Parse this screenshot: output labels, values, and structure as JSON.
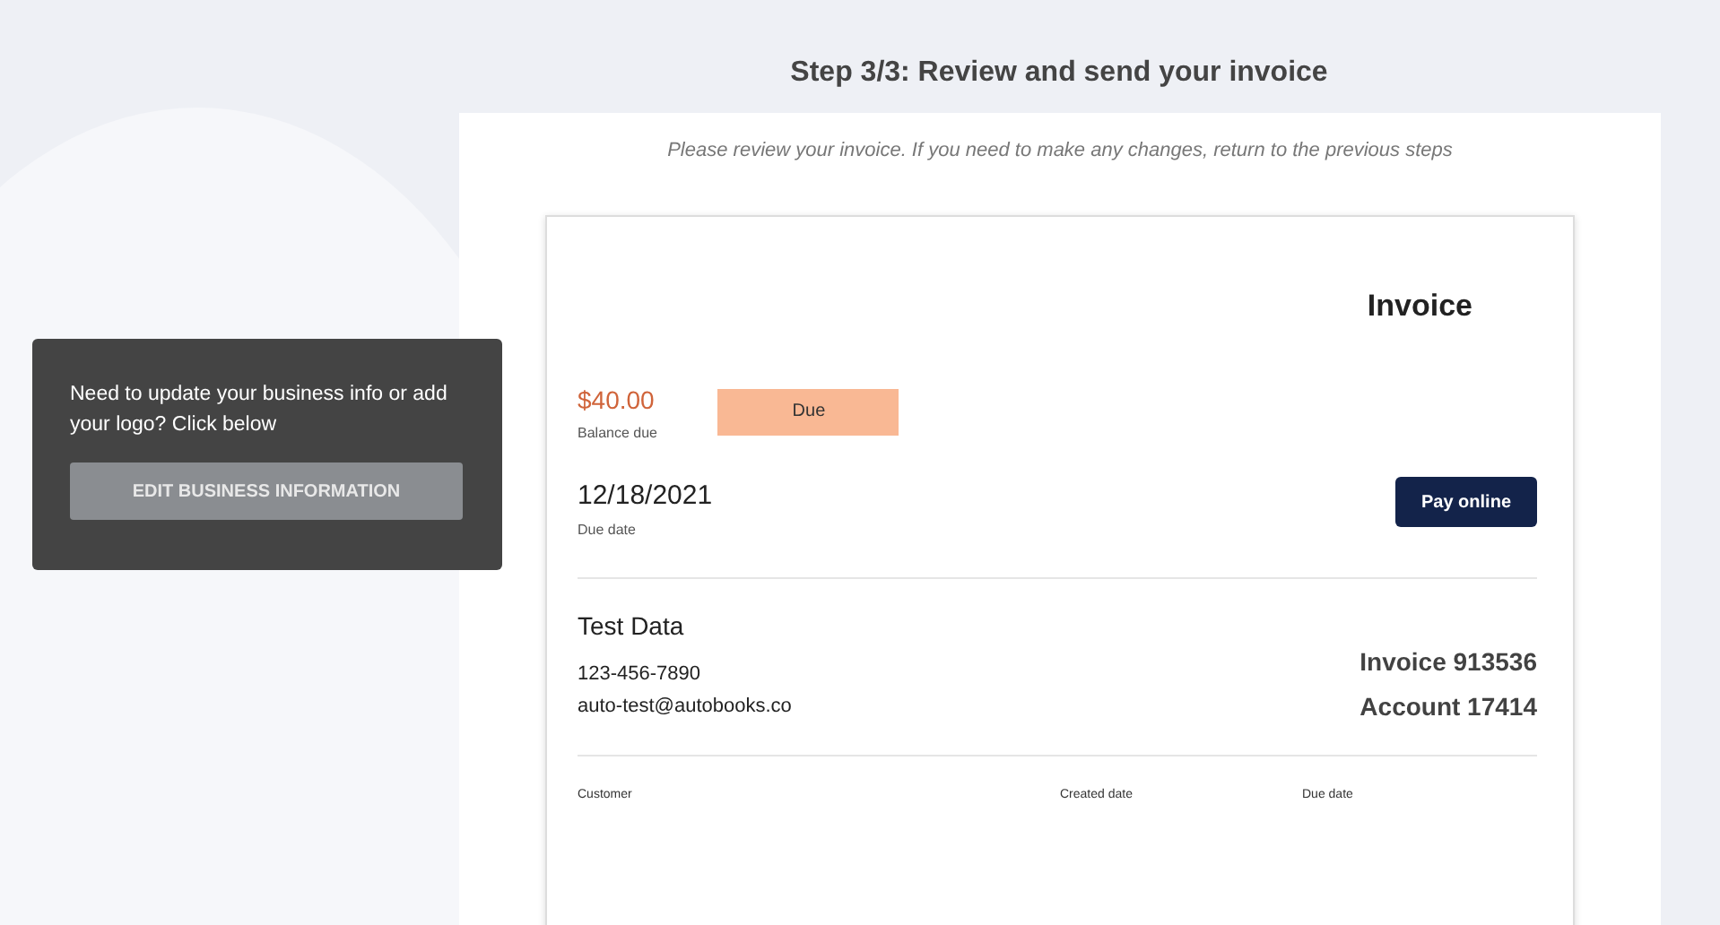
{
  "page": {
    "title": "Step 3/3: Review and send your invoice",
    "instructions": "Please review your invoice. If you need to make any changes, return to the previous steps"
  },
  "business_prompt": {
    "message": "Need to update your business info or add your logo? Click below",
    "button": "EDIT BUSINESS INFORMATION"
  },
  "invoice": {
    "heading": "Invoice",
    "balance": "$40.00",
    "balance_label": "Balance due",
    "status": "Due",
    "due_date": "12/18/2021",
    "due_date_label": "Due date",
    "pay_button": "Pay online",
    "business": {
      "name": "Test Data",
      "phone": "123-456-7890",
      "email": "auto-test@autobooks.co"
    },
    "invoice_number": "Invoice 913536",
    "account_number": "Account 17414",
    "detail_columns": [
      "Customer",
      "Created date",
      "Due date"
    ]
  }
}
